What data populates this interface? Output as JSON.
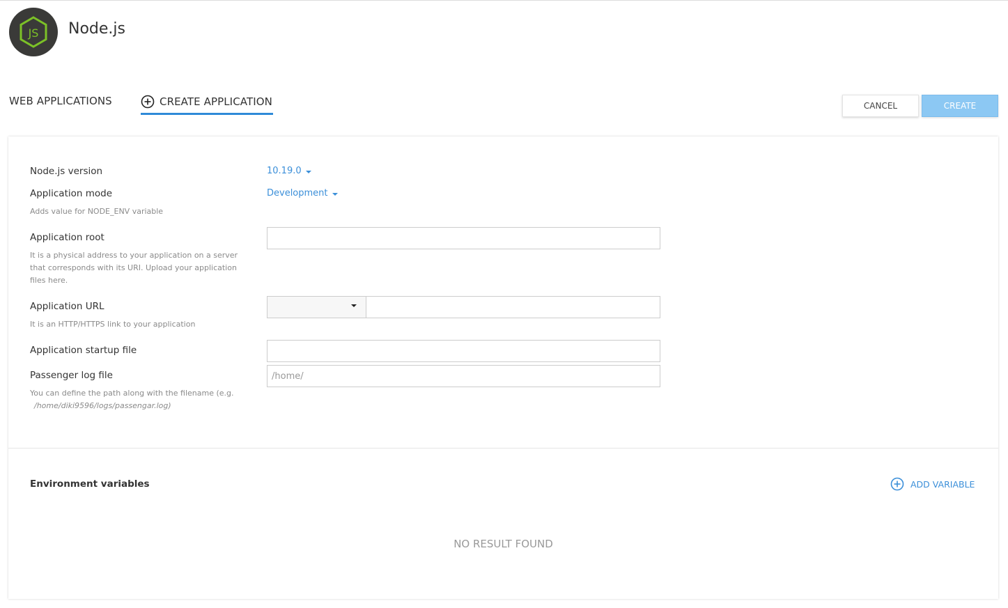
{
  "header": {
    "logo_text": "JS",
    "title": "Node.js"
  },
  "tabs": [
    {
      "label": "WEB APPLICATIONS"
    },
    {
      "label": "CREATE APPLICATION"
    }
  ],
  "actions": {
    "cancel_label": "CANCEL",
    "create_label": "CREATE"
  },
  "form": {
    "node_version": {
      "label": "Node.js version",
      "value": "10.19.0"
    },
    "app_mode": {
      "label": "Application mode",
      "value": "Development",
      "hint": "Adds value for NODE_ENV variable"
    },
    "app_root": {
      "label": "Application root",
      "hint": "It is a physical address to your application on a server that corresponds with its URI. Upload your application files here.",
      "value": ""
    },
    "app_url": {
      "label": "Application URL",
      "hint": "It is an HTTP/HTTPS link to your application",
      "value": ""
    },
    "startup_file": {
      "label": "Application startup file",
      "value": ""
    },
    "log_file": {
      "label": "Passenger log file",
      "placeholder": "/home/",
      "hint_prefix": "You can define the path along with the filename (e.g.",
      "hint_example": "/home/diki9596/logs/passengar.log)"
    }
  },
  "env": {
    "title": "Environment variables",
    "add_label": "ADD VARIABLE",
    "empty_text": "NO RESULT FOUND"
  },
  "colors": {
    "accent": "#2f8ad8",
    "link": "#3b8fd9",
    "create_button": "#8cc8f3",
    "logo_bg": "#3a3a38",
    "logo_green": "#7cc127"
  },
  "icons": {
    "logo": "nodejs-hexagon-icon",
    "tab_create": "plus-circle-icon",
    "add_variable": "plus-circle-icon",
    "dropdown": "caret-down-icon"
  }
}
